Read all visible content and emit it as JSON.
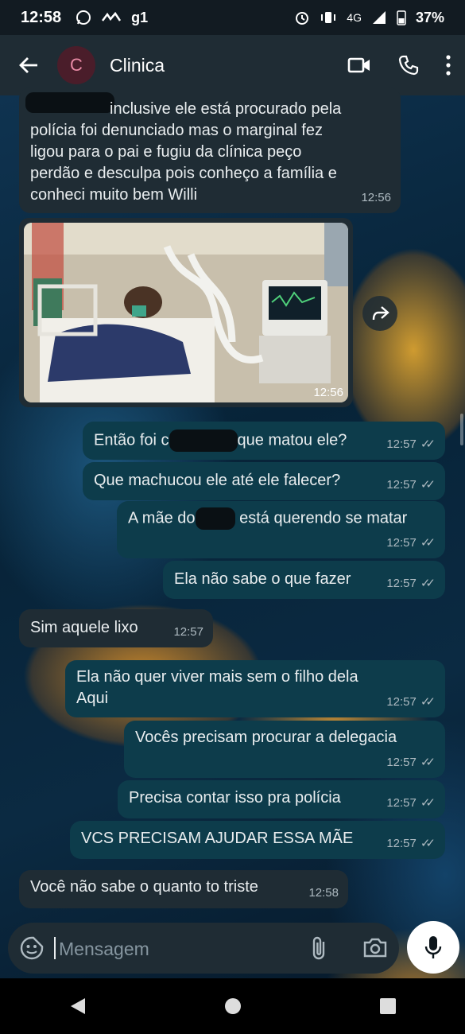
{
  "status_bar": {
    "time": "12:58",
    "app_labels": [
      "g1"
    ],
    "network": "4G",
    "battery": "37%"
  },
  "header": {
    "avatar_letter": "C",
    "title": "Clinica"
  },
  "messages": [
    {
      "dir": "in",
      "text": "inclusive ele está procurado pela\npolícia foi denunciado mas o marginal fez\nligou para o pai e fugiu da clínica peço\nperdão e desculpa pois conheço a família e\nconheci muito bem Willi",
      "time": "12:56"
    },
    {
      "dir": "in",
      "type": "image",
      "time": "12:56"
    },
    {
      "dir": "out",
      "text_before": "Então foi c",
      "text_after": "que matou ele?",
      "time": "12:57"
    },
    {
      "dir": "out",
      "text": "Que machucou ele até ele falecer?",
      "time": "12:57"
    },
    {
      "dir": "out",
      "text_before": "A mãe do",
      "text_after": "está querendo se matar",
      "time": "12:57"
    },
    {
      "dir": "out",
      "text": "Ela não sabe o que fazer",
      "time": "12:57"
    },
    {
      "dir": "in",
      "text": "Sim aquele lixo",
      "time": "12:57"
    },
    {
      "dir": "out",
      "text": "Ela não quer viver mais sem o filho dela\nAqui",
      "time": "12:57"
    },
    {
      "dir": "out",
      "text": "Vocês precisam procurar a delegacia",
      "time": "12:57"
    },
    {
      "dir": "out",
      "text": "Precisa contar isso pra polícia",
      "time": "12:57"
    },
    {
      "dir": "out",
      "text": "VCS PRECISAM AJUDAR ESSA MÃE",
      "time": "12:57"
    },
    {
      "dir": "in",
      "text": "Você não sabe o quanto to triste",
      "time": "12:58"
    }
  ],
  "composer": {
    "placeholder": "Mensagem"
  },
  "colors": {
    "incoming": "#1f2c34",
    "outgoing": "#0d3c4b",
    "header": "#1f2c34",
    "mic": "#ffffff"
  }
}
